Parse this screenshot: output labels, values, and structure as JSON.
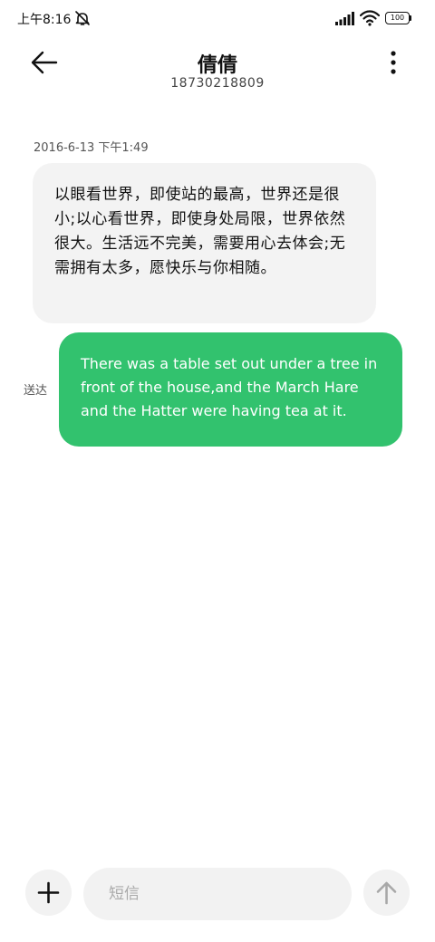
{
  "status_bar": {
    "time": "上午8:16",
    "battery": "100",
    "icons": [
      "mute-icon",
      "signal-icon",
      "wifi-icon",
      "battery-icon"
    ]
  },
  "header": {
    "contact_name": "倩倩",
    "contact_number": "18730218809",
    "icons": [
      "back-arrow-icon",
      "more-vert-icon"
    ]
  },
  "conversation": {
    "timestamp": "2016-6-13 下午1:49",
    "incoming_message": "以眼看世界，即使站的最高，世界还是很小;以心看世界，即使身处局限，世界依然很大。生活远不完美，需要用心去体会;无需拥有太多，愿快乐与你相随。",
    "outgoing_message": "There was a table set out under a tree in front of the house,and the March Hare and the Hatter were having tea at it.",
    "outgoing_status": "送达"
  },
  "compose": {
    "placeholder": "短信",
    "icons": [
      "plus-icon",
      "send-arrow-icon"
    ]
  },
  "colors": {
    "outgoing_bubble": "#32c26e",
    "incoming_bubble": "#f3f3f3",
    "input_background": "#f2f2f2"
  }
}
